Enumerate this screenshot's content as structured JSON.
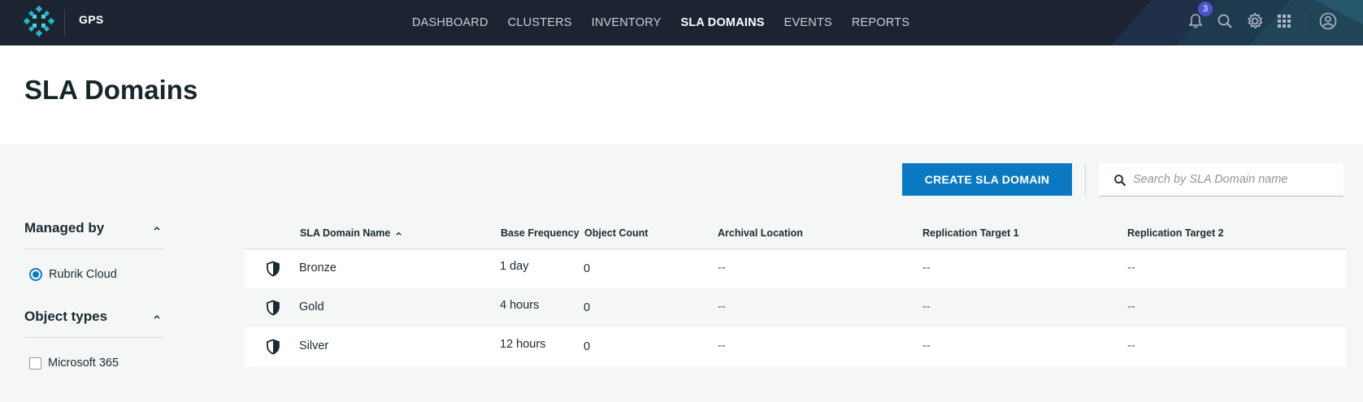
{
  "app": {
    "org_name": "GPS",
    "notifications_count": "3"
  },
  "nav": {
    "items": [
      "DASHBOARD",
      "CLUSTERS",
      "INVENTORY",
      "SLA DOMAINS",
      "EVENTS",
      "REPORTS"
    ],
    "active": "SLA DOMAINS"
  },
  "icons": {
    "notifications": "bell-icon",
    "search": "search-icon",
    "settings": "gear-icon",
    "apps": "grid-icon",
    "account": "user-circle-icon",
    "row": "shield-icon"
  },
  "colors": {
    "accent": "#0b79c1",
    "topbar": "#1c2431",
    "badge": "#4b54c9"
  },
  "page": {
    "title": "SLA Domains"
  },
  "toolbar": {
    "create_label": "CREATE SLA DOMAIN",
    "search_placeholder": "Search by SLA Domain name",
    "search_value": ""
  },
  "filters": {
    "managed_by": {
      "title": "Managed by",
      "options": [
        {
          "label": "Rubrik Cloud",
          "selected": true
        }
      ]
    },
    "object_types": {
      "title": "Object types",
      "options": [
        {
          "label": "Microsoft 365",
          "checked": false
        }
      ]
    }
  },
  "table": {
    "columns": [
      "SLA Domain Name",
      "Base Frequency",
      "Object Count",
      "Archival Location",
      "Replication Target 1",
      "Replication Target 2"
    ],
    "sorted_column": "SLA Domain Name",
    "sort_direction": "ascending",
    "rows": [
      {
        "name": "Bronze",
        "frequency": "1 day",
        "count": "0",
        "archival": "--",
        "rep1": "--",
        "rep2": "--"
      },
      {
        "name": "Gold",
        "frequency": "4 hours",
        "count": "0",
        "archival": "--",
        "rep1": "--",
        "rep2": "--"
      },
      {
        "name": "Silver",
        "frequency": "12 hours",
        "count": "0",
        "archival": "--",
        "rep1": "--",
        "rep2": "--"
      }
    ]
  }
}
